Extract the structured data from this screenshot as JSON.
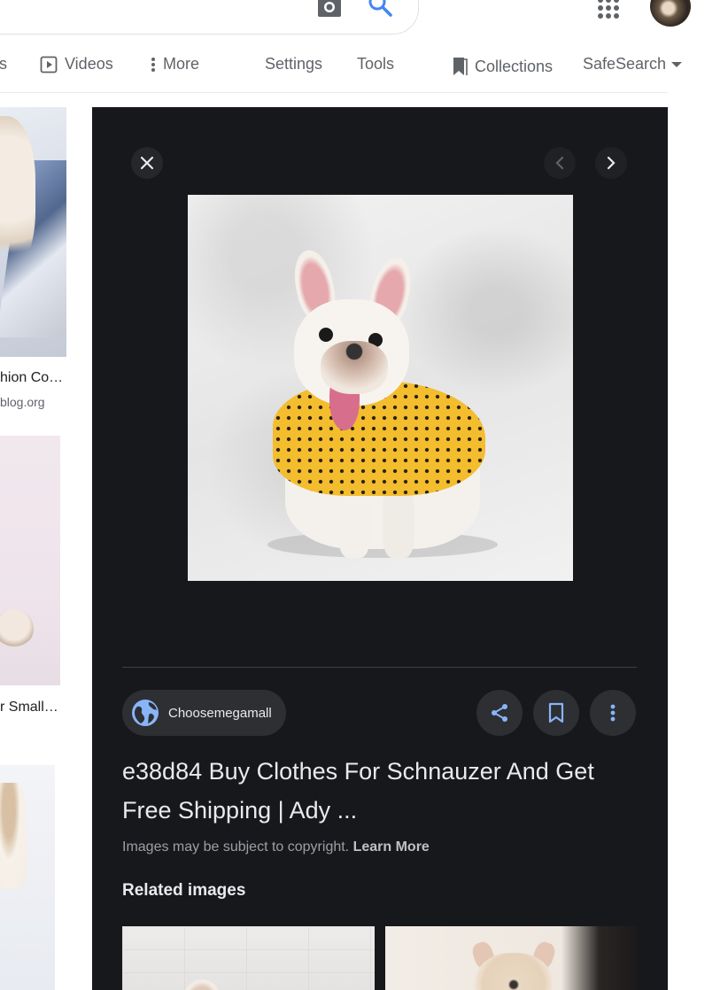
{
  "header": {
    "camera_icon": "camera-icon",
    "search_icon": "search-icon",
    "apps_icon": "apps-grid-icon",
    "accent_color": "#4285f4"
  },
  "tabs": {
    "partial_left": "s",
    "videos": "Videos",
    "more": "More",
    "settings": "Settings",
    "tools": "Tools",
    "collections": "Collections",
    "safesearch": "SafeSearch"
  },
  "results": {
    "item1": {
      "caption": "hion Co…",
      "source": "blog.org"
    },
    "item2": {
      "caption": "r Small…"
    }
  },
  "preview": {
    "source_name": "Choosemegamall",
    "title": "e38d84 Buy Clothes For Schnauzer And Get Free Shipping | Ady ...",
    "copyright_text": "Images may be subject to copyright.",
    "learn_more": "Learn More",
    "related_heading": "Related images",
    "panel_background": "#17181b"
  }
}
